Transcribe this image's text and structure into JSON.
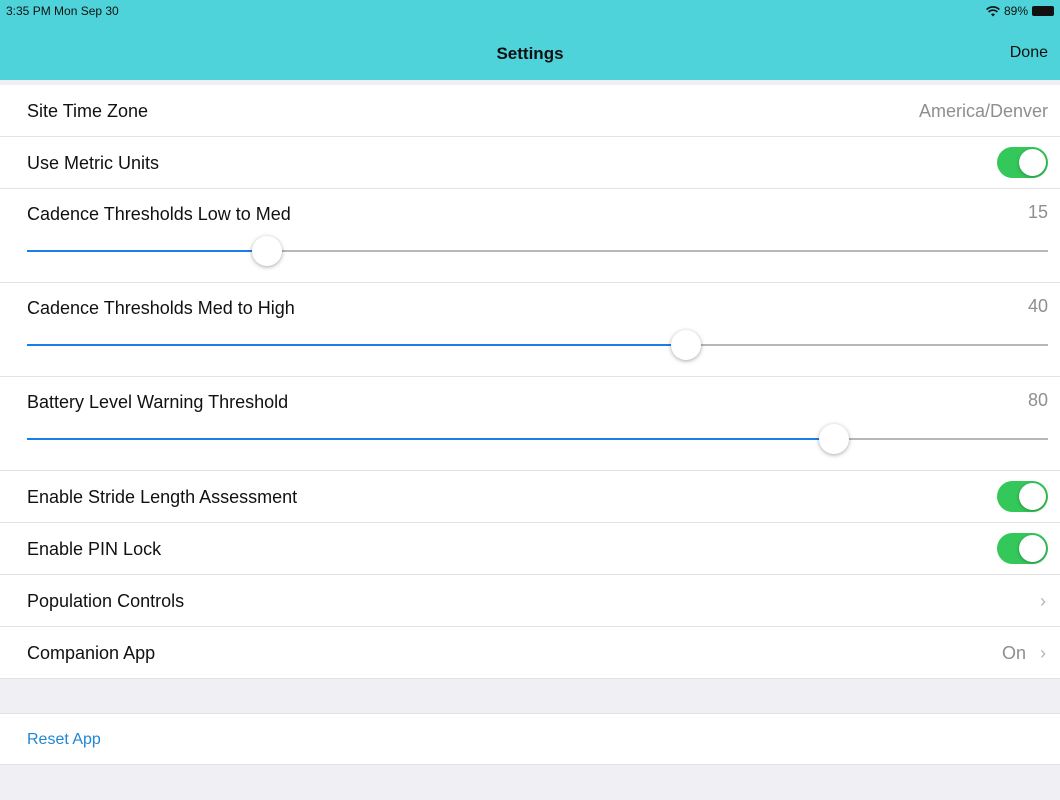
{
  "status_bar": {
    "time": "3:35 PM  Mon Sep 30",
    "battery": "89%"
  },
  "nav": {
    "title": "Settings",
    "done_label": "Done"
  },
  "rows": {
    "timezone": {
      "label": "Site Time Zone",
      "value": "America/Denver"
    },
    "metric": {
      "label": "Use Metric Units",
      "on": true
    },
    "cadence_low": {
      "label": "Cadence Thresholds Low to Med",
      "value": "15",
      "fraction": 0.235
    },
    "cadence_high": {
      "label": "Cadence Thresholds Med to High",
      "value": "40",
      "fraction": 0.645
    },
    "battery": {
      "label": "Battery Level Warning Threshold",
      "value": "80",
      "fraction": 0.79
    },
    "stride": {
      "label": "Enable Stride Length Assessment",
      "on": true
    },
    "pin": {
      "label": "Enable PIN Lock",
      "on": true
    },
    "population": {
      "label": "Population Controls",
      "chevron": "›"
    },
    "companion": {
      "label": "Companion App",
      "value": "On",
      "chevron": "›"
    }
  },
  "reset": {
    "label": "Reset App"
  },
  "colors": {
    "header": "#4fd3da",
    "toggle_on": "#34c759",
    "slider_fill": "#1a7ee6",
    "link": "#1f86d6"
  },
  "icons": {
    "wifi": "wifi-icon",
    "battery": "battery-icon",
    "chevron": "chevron-right-icon"
  }
}
